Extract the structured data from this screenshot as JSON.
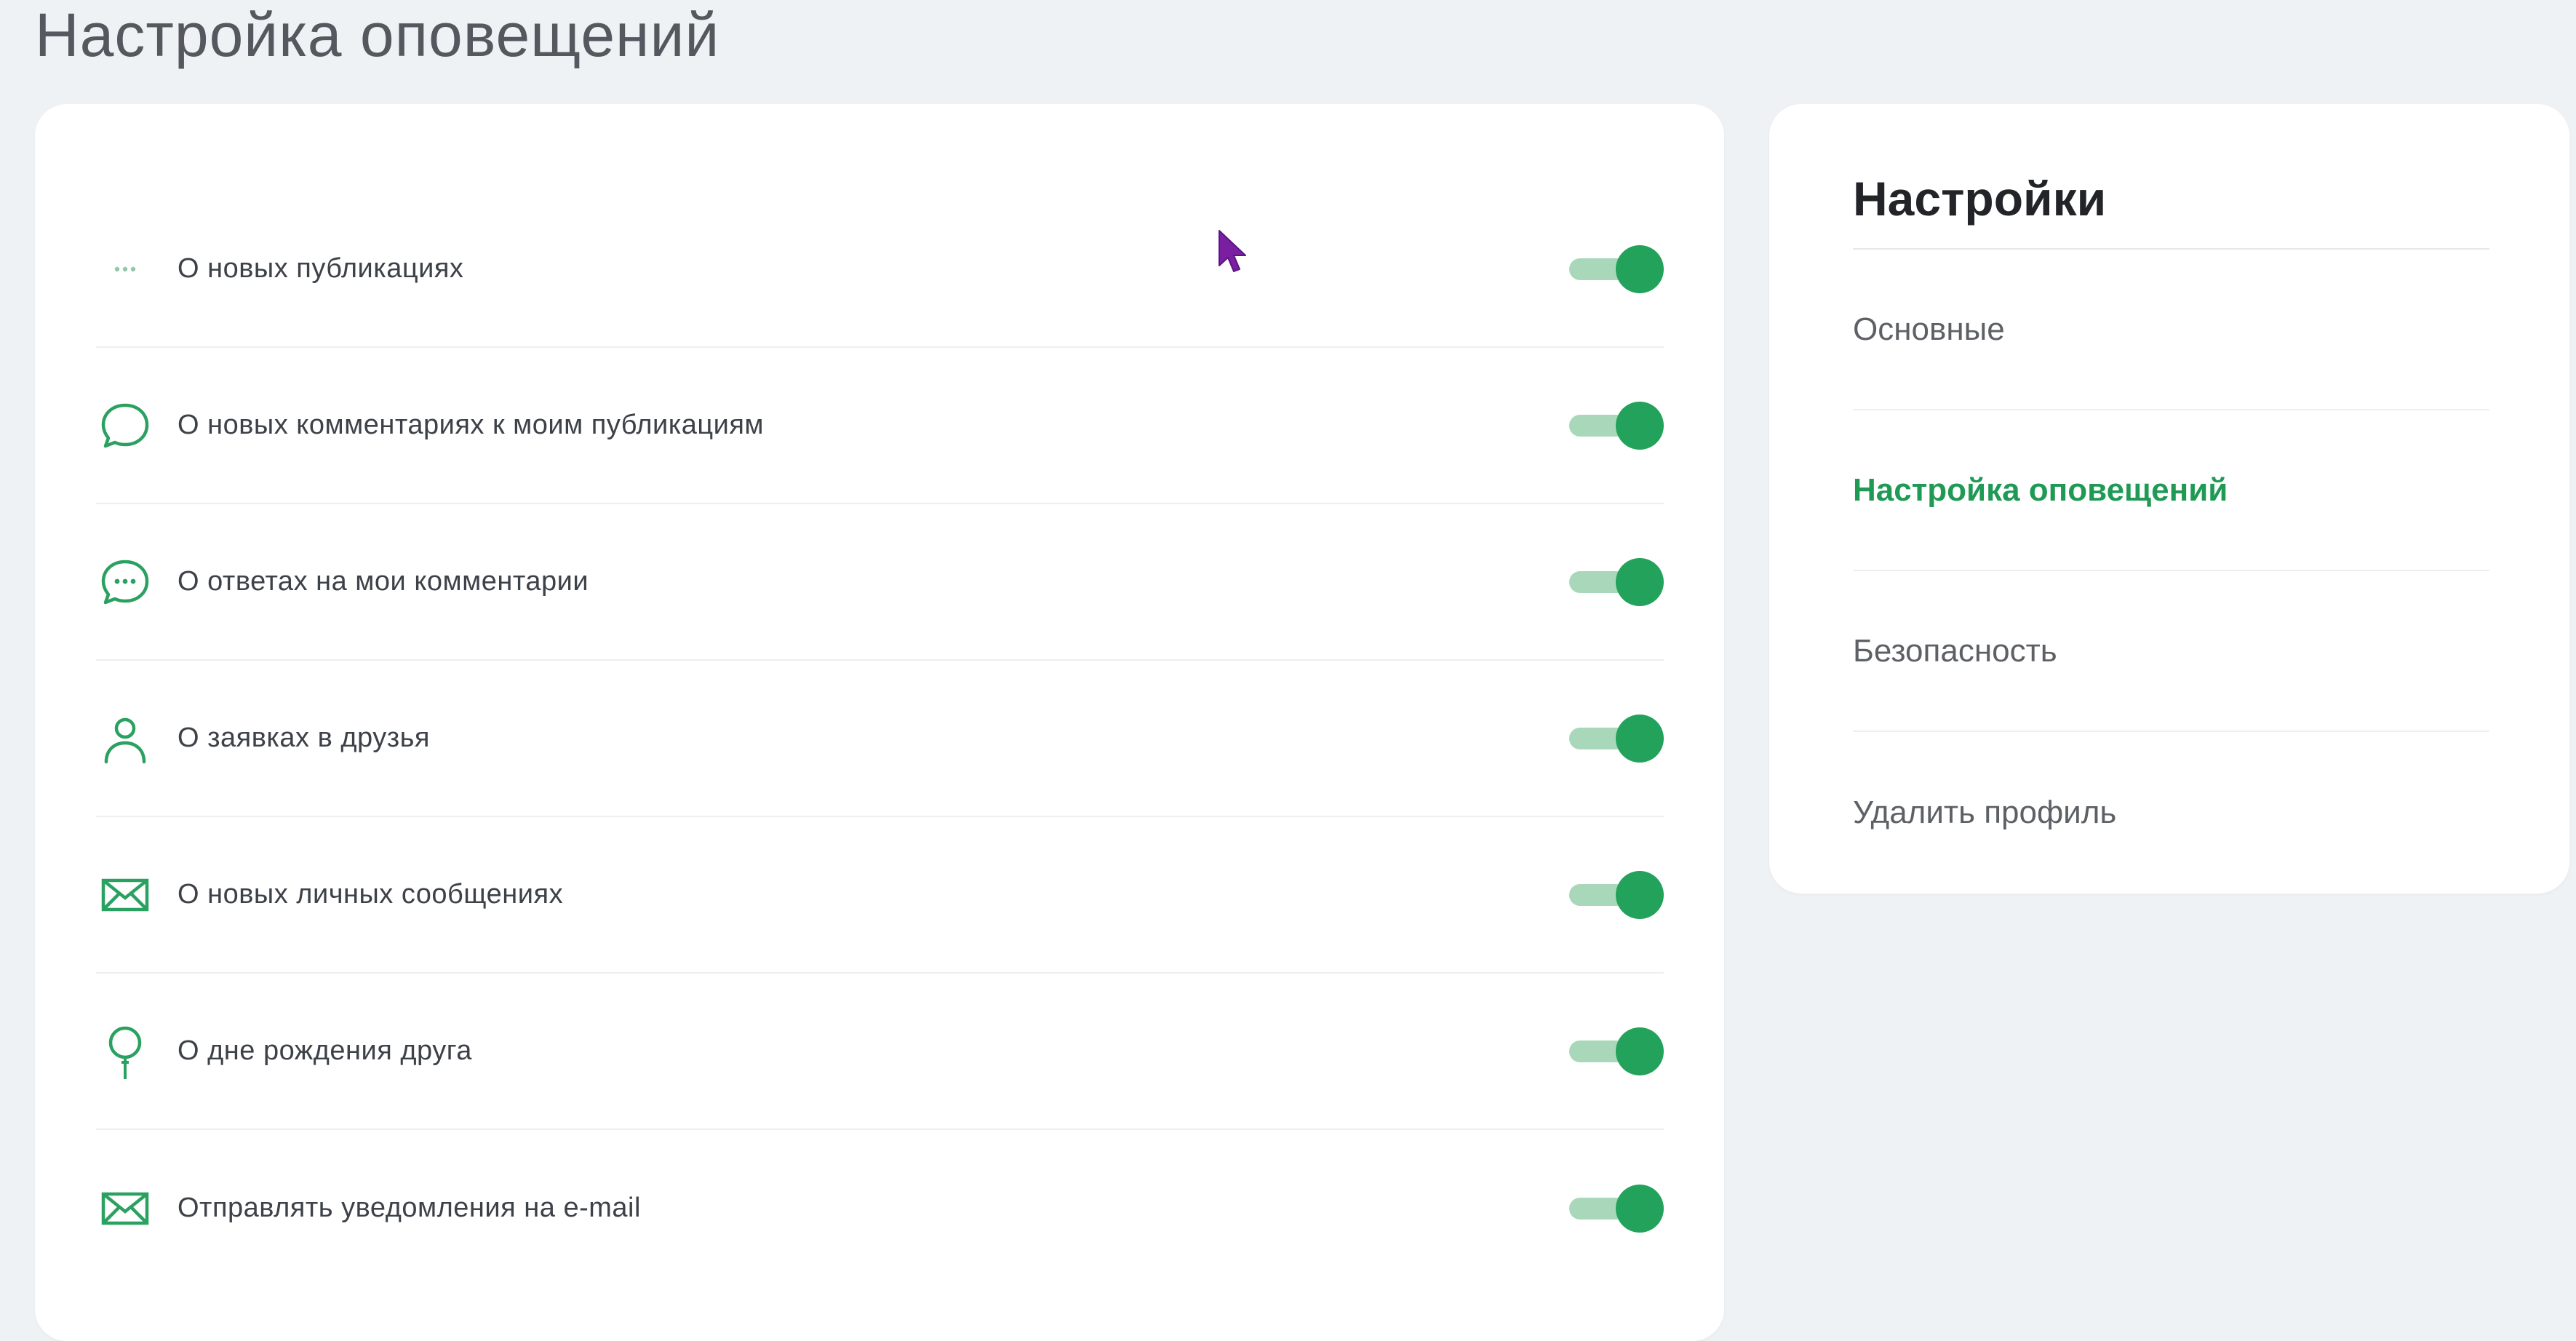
{
  "page": {
    "title": "Настройка оповещений"
  },
  "notifications": {
    "items": [
      {
        "label": "О новых публикациях",
        "icon": "dots-icon",
        "enabled": true
      },
      {
        "label": "О новых комментариях к моим публикациям",
        "icon": "comment-icon",
        "enabled": true
      },
      {
        "label": "О ответах на мои комментарии",
        "icon": "comment-dots-icon",
        "enabled": true
      },
      {
        "label": "О заявках в друзья",
        "icon": "user-icon",
        "enabled": true
      },
      {
        "label": "О новых личных сообщениях",
        "icon": "envelope-icon",
        "enabled": true
      },
      {
        "label": "О дне рождения друга",
        "icon": "balloon-icon",
        "enabled": true
      },
      {
        "label": "Отправлять уведомления на e-mail",
        "icon": "envelope-icon",
        "enabled": true
      }
    ]
  },
  "settings_menu": {
    "title": "Настройки",
    "items": [
      {
        "label": "Основные",
        "active": false
      },
      {
        "label": "Настройка оповещений",
        "active": true
      },
      {
        "label": "Безопасность",
        "active": false
      },
      {
        "label": "Удалить профиль",
        "active": false
      }
    ]
  },
  "colors": {
    "accent": "#22a25a",
    "accent_light": "#a8d8b9",
    "background": "#eff2f5",
    "card": "#ffffff",
    "cursor": "#7a1fa2"
  }
}
